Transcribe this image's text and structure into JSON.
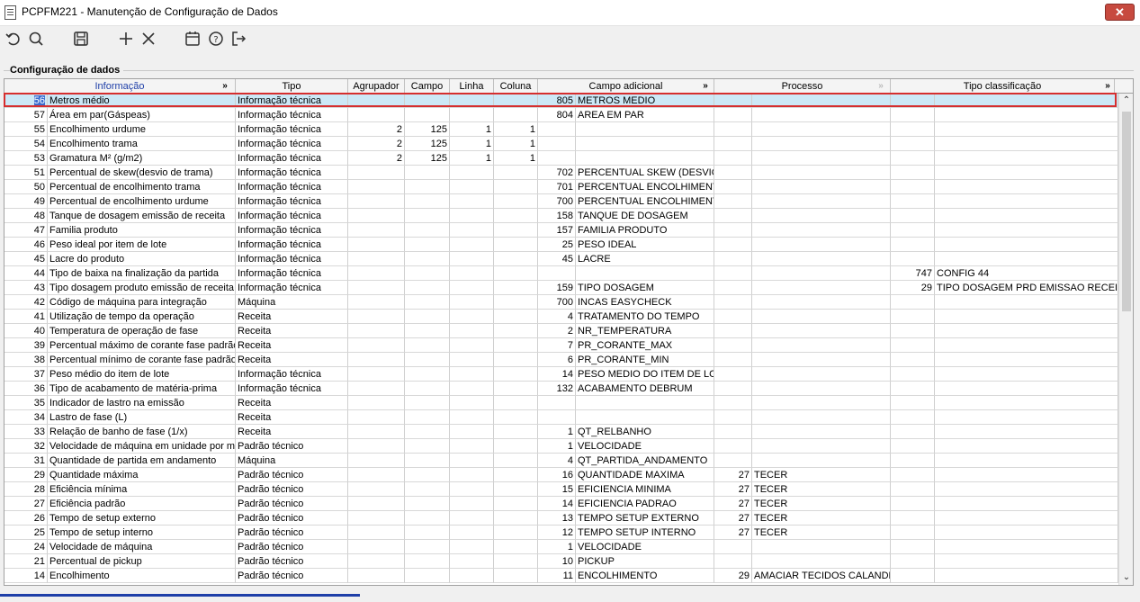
{
  "window": {
    "title": "PCPFM221 - Manutenção de Configuração de Dados",
    "close_label": "✕"
  },
  "toolbar": {
    "icons": [
      "refresh-icon",
      "search-icon",
      "save-icon",
      "add-icon",
      "delete-icon",
      "calendar-icon",
      "help-icon",
      "exit-icon"
    ]
  },
  "section": {
    "title": "Configuração de dados"
  },
  "grid": {
    "headers": [
      "Informação",
      "Tipo",
      "Agrupador",
      "Campo",
      "Linha",
      "Coluna",
      "Campo adicional",
      "Processo",
      "Tipo classificação"
    ],
    "expand_label": "»",
    "rows": [
      [
        "56",
        "Metros médio",
        "Informação técnica",
        "",
        "",
        "",
        "",
        "805",
        "METROS MEDIO",
        "",
        "",
        "",
        ""
      ],
      [
        "57",
        "Área em par(Gáspeas)",
        "Informação técnica",
        "",
        "",
        "",
        "",
        "804",
        "AREA EM PAR",
        "",
        "",
        "",
        ""
      ],
      [
        "55",
        "Encolhimento urdume",
        "Informação técnica",
        "2",
        "125",
        "1",
        "1",
        "",
        "",
        "",
        "",
        "",
        ""
      ],
      [
        "54",
        "Encolhimento trama",
        "Informação técnica",
        "2",
        "125",
        "1",
        "1",
        "",
        "",
        "",
        "",
        "",
        ""
      ],
      [
        "53",
        "Gramatura M² (g/m2)",
        "Informação técnica",
        "2",
        "125",
        "1",
        "1",
        "",
        "",
        "",
        "",
        "",
        ""
      ],
      [
        "51",
        "Percentual de skew(desvio de trama)",
        "Informação técnica",
        "",
        "",
        "",
        "",
        "702",
        "PERCENTUAL SKEW (DESVIO T",
        "",
        "",
        "",
        ""
      ],
      [
        "50",
        "Percentual de encolhimento trama",
        "Informação técnica",
        "",
        "",
        "",
        "",
        "701",
        "PERCENTUAL ENCOLHIMENTO",
        "",
        "",
        "",
        ""
      ],
      [
        "49",
        "Percentual de encolhimento urdume",
        "Informação técnica",
        "",
        "",
        "",
        "",
        "700",
        "PERCENTUAL ENCOLHIMENTO",
        "",
        "",
        "",
        ""
      ],
      [
        "48",
        "Tanque de dosagem emissão de receita",
        "Informação técnica",
        "",
        "",
        "",
        "",
        "158",
        "TANQUE DE DOSAGEM",
        "",
        "",
        "",
        ""
      ],
      [
        "47",
        "Familia produto",
        "Informação técnica",
        "",
        "",
        "",
        "",
        "157",
        "FAMILIA PRODUTO",
        "",
        "",
        "",
        ""
      ],
      [
        "46",
        "Peso ideal por item de lote",
        "Informação técnica",
        "",
        "",
        "",
        "",
        "25",
        "PESO IDEAL",
        "",
        "",
        "",
        ""
      ],
      [
        "45",
        "Lacre do produto",
        "Informação técnica",
        "",
        "",
        "",
        "",
        "45",
        "LACRE",
        "",
        "",
        "",
        ""
      ],
      [
        "44",
        "Tipo de baixa na finalização da partida",
        "Informação técnica",
        "",
        "",
        "",
        "",
        "",
        "",
        "",
        "",
        "747",
        "CONFIG 44"
      ],
      [
        "43",
        "Tipo dosagem produto emissão de receita",
        "Informação técnica",
        "",
        "",
        "",
        "",
        "159",
        "TIPO DOSAGEM",
        "",
        "",
        "29",
        "TIPO DOSAGEM PRD EMISSAO RECEITA"
      ],
      [
        "42",
        "Código de máquina para integração",
        "Máquina",
        "",
        "",
        "",
        "",
        "700",
        "INCAS EASYCHECK",
        "",
        "",
        "",
        ""
      ],
      [
        "41",
        "Utilização de tempo da operação",
        "Receita",
        "",
        "",
        "",
        "",
        "4",
        "TRATAMENTO DO TEMPO",
        "",
        "",
        "",
        ""
      ],
      [
        "40",
        "Temperatura de operação de fase",
        "Receita",
        "",
        "",
        "",
        "",
        "2",
        "NR_TEMPERATURA",
        "",
        "",
        "",
        ""
      ],
      [
        "39",
        "Percentual máximo de corante fase padrão",
        "Receita",
        "",
        "",
        "",
        "",
        "7",
        "PR_CORANTE_MAX",
        "",
        "",
        "",
        ""
      ],
      [
        "38",
        "Percentual mínimo de corante fase padrão",
        "Receita",
        "",
        "",
        "",
        "",
        "6",
        "PR_CORANTE_MIN",
        "",
        "",
        "",
        ""
      ],
      [
        "37",
        "Peso médio do item de lote",
        "Informação técnica",
        "",
        "",
        "",
        "",
        "14",
        "PESO MEDIO DO ITEM DE LOTE",
        "",
        "",
        "",
        ""
      ],
      [
        "36",
        "Tipo de acabamento de matéria-prima",
        "Informação técnica",
        "",
        "",
        "",
        "",
        "132",
        "ACABAMENTO DEBRUM",
        "",
        "",
        "",
        ""
      ],
      [
        "35",
        "Indicador de lastro na emissão",
        "Receita",
        "",
        "",
        "",
        "",
        "",
        "",
        "",
        "",
        "",
        ""
      ],
      [
        "34",
        "Lastro de fase (L)",
        "Receita",
        "",
        "",
        "",
        "",
        "",
        "",
        "",
        "",
        "",
        ""
      ],
      [
        "33",
        "Relação de banho de fase (1/x)",
        "Receita",
        "",
        "",
        "",
        "",
        "1",
        "QT_RELBANHO",
        "",
        "",
        "",
        ""
      ],
      [
        "32",
        "Velocidade de máquina em unidade por min",
        "Padrão técnico",
        "",
        "",
        "",
        "",
        "1",
        "VELOCIDADE",
        "",
        "",
        "",
        ""
      ],
      [
        "31",
        "Quantidade de partida em andamento",
        "Máquina",
        "",
        "",
        "",
        "",
        "4",
        "QT_PARTIDA_ANDAMENTO",
        "",
        "",
        "",
        ""
      ],
      [
        "29",
        "Quantidade máxima",
        "Padrão técnico",
        "",
        "",
        "",
        "",
        "16",
        "QUANTIDADE MAXIMA",
        "27",
        "TECER",
        "",
        ""
      ],
      [
        "28",
        "Eficiência mínima",
        "Padrão técnico",
        "",
        "",
        "",
        "",
        "15",
        "EFICIENCIA MINIMA",
        "27",
        "TECER",
        "",
        ""
      ],
      [
        "27",
        "Eficiência padrão",
        "Padrão técnico",
        "",
        "",
        "",
        "",
        "14",
        "EFICIENCIA PADRAO",
        "27",
        "TECER",
        "",
        ""
      ],
      [
        "26",
        "Tempo de setup externo",
        "Padrão técnico",
        "",
        "",
        "",
        "",
        "13",
        "TEMPO SETUP EXTERNO",
        "27",
        "TECER",
        "",
        ""
      ],
      [
        "25",
        "Tempo de setup interno",
        "Padrão técnico",
        "",
        "",
        "",
        "",
        "12",
        "TEMPO SETUP INTERNO",
        "27",
        "TECER",
        "",
        ""
      ],
      [
        "24",
        "Velocidade de máquina",
        "Padrão técnico",
        "",
        "",
        "",
        "",
        "1",
        "VELOCIDADE",
        "",
        "",
        "",
        ""
      ],
      [
        "21",
        "Percentual de pickup",
        "Padrão técnico",
        "",
        "",
        "",
        "",
        "10",
        "PICKUP",
        "",
        "",
        "",
        ""
      ],
      [
        "14",
        "Encolhimento",
        "Padrão técnico",
        "",
        "",
        "",
        "",
        "11",
        "ENCOLHIMENTO",
        "29",
        "AMACIAR TECIDOS CALANDRA",
        "",
        ""
      ]
    ]
  },
  "scrollbar": {
    "up": "⌃",
    "down": "⌄"
  }
}
